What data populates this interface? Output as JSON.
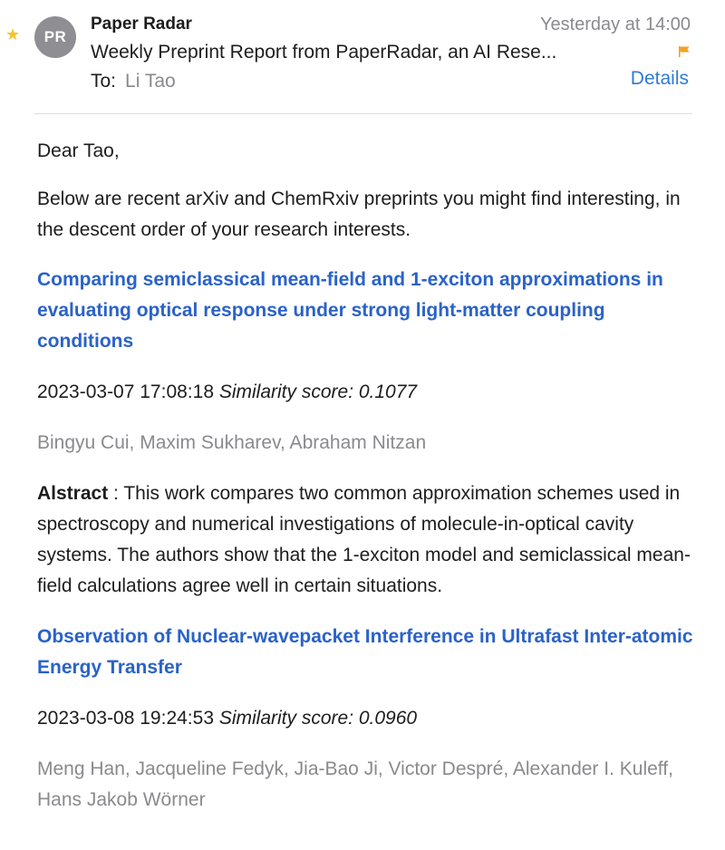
{
  "email": {
    "sender_initials": "PR",
    "sender_name": "Paper Radar",
    "date": "Yesterday at 14:00",
    "subject": "Weekly Preprint Report from PaperRadar, an AI Rese...",
    "to_label": "To:",
    "to_name": "Li Tao",
    "details_label": "Details",
    "star_glyph": "★",
    "flag_color": "#f4a024",
    "star_color": "#f5c230"
  },
  "body": {
    "greeting": "Dear Tao,",
    "intro": "Below are recent arXiv and ChemRxiv preprints you might find interesting, in the descent order of your research interests.",
    "papers": [
      {
        "title": "Comparing semiclassical mean-field and 1-exciton approximations in evaluating optical response under strong light-matter coupling conditions",
        "datetime": "2023-03-07 17:08:18",
        "score_label": "Similarity score: 0.1077",
        "authors": "Bingyu Cui, Maxim Sukharev, Abraham Nitzan",
        "abstract_label": "Alstract",
        "abstract_text": " : This work compares two common approximation schemes used in spectroscopy and numerical investigations of molecule-in-optical cavity systems. The authors show that the 1-exciton model and semiclassical mean-field calculations agree well in certain situations."
      },
      {
        "title": "Observation of Nuclear-wavepacket Interference in Ultrafast Inter-atomic Energy Transfer",
        "datetime": "2023-03-08 19:24:53",
        "score_label": "Similarity score: 0.0960",
        "authors": "Meng Han, Jacqueline Fedyk, Jia-Bao Ji, Victor Despré, Alexander I. Kuleff, Hans Jakob Wörner"
      }
    ]
  }
}
